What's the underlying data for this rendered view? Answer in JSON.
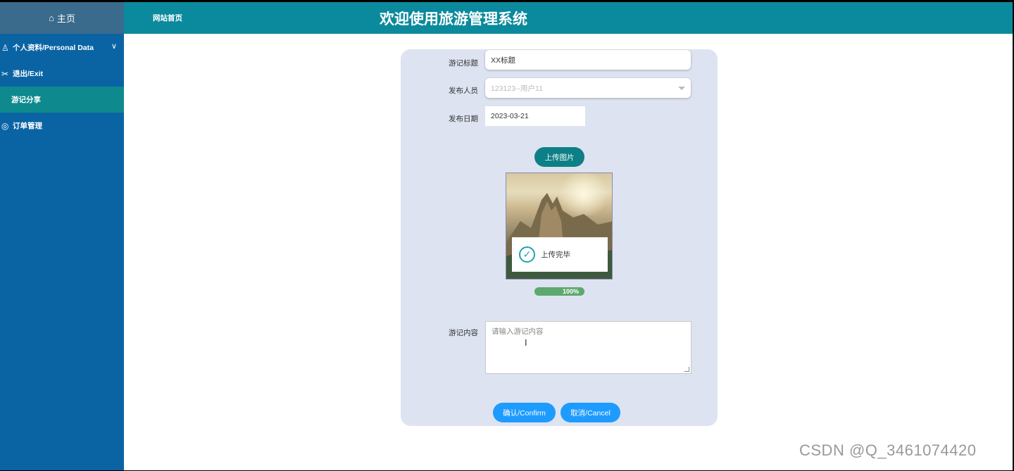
{
  "sidebar": {
    "home_icon": "home-icon",
    "home_label": "主页",
    "items": [
      {
        "icon": "user-icon",
        "label": "个人资料/Personal Data",
        "has_chevron": true
      },
      {
        "icon": "exit-icon",
        "label": "退出/Exit"
      },
      {
        "label": "游记分享",
        "active": true
      },
      {
        "icon": "order-icon",
        "label": "订单管理"
      }
    ]
  },
  "header": {
    "nav_home": "网站首页",
    "title": "欢迎使用旅游管理系统"
  },
  "form": {
    "title_label": "游记标题",
    "title_value": "XX标题",
    "publisher_label": "发布人员",
    "publisher_value": "123123--用户11",
    "date_label": "发布日期",
    "date_value": "2023-03-21",
    "upload_button": "上传图片",
    "upload_toast": "上传完毕",
    "upload_progress": "100%",
    "upload_progress_fraction": 1.0,
    "content_label": "游记内容",
    "content_placeholder": "请输入游记内容",
    "confirm_button": "确认/Confirm",
    "cancel_button": "取消/Cancel"
  },
  "watermark": "CSDN @Q_3461074420",
  "colors": {
    "sidebar": "#0a64a4",
    "header": "#0a8a9c",
    "active_item": "#0e8a8e",
    "primary_button": "#1e9bff",
    "upload_button": "#0d7f86",
    "progress": "#5ea86e",
    "panel": "#dde3f0"
  }
}
